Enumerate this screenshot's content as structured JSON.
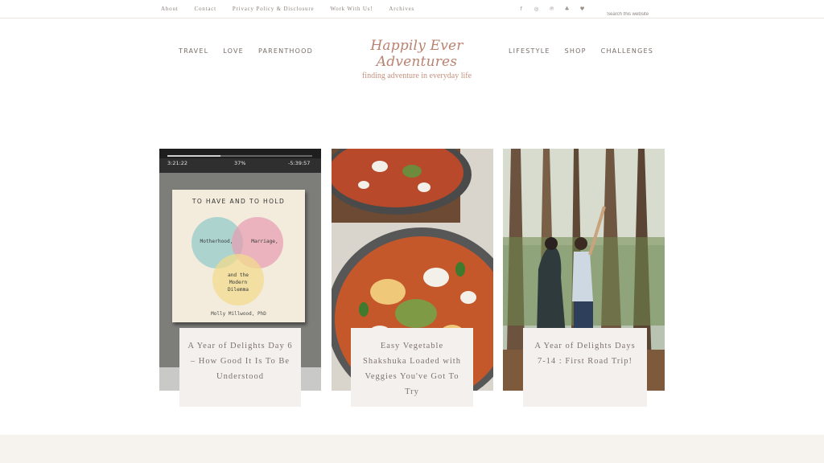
{
  "topbar": {
    "links": [
      "About",
      "Contact",
      "Privacy Policy & Disclosure",
      "Work With Us!",
      "Archives"
    ],
    "social_icons": [
      "facebook-icon",
      "instagram-icon",
      "pinterest-icon",
      "bloglovin-icon",
      "twitter-icon"
    ],
    "search_placeholder": "Search this website"
  },
  "header": {
    "nav_left": [
      "TRAVEL",
      "LOVE",
      "PARENTHOOD"
    ],
    "nav_right": [
      "LIFESTYLE",
      "SHOP",
      "CHALLENGES"
    ],
    "logo_title": "Happily Ever Adventures",
    "tagline": "finding adventure in everyday life"
  },
  "posts": [
    {
      "title": "A Year of Delights Day 6 – How Good It Is To Be Understood",
      "book": {
        "time_elapsed": "3:21:22",
        "percent": "37%",
        "time_remaining": "-5:39:57",
        "title": "TO HAVE AND TO HOLD",
        "circle_left": "Motherhood,",
        "circle_right": "Marriage,",
        "circle_bottom": "and the Modern Dilemma",
        "author": "Molly Millwood, PhD"
      }
    },
    {
      "title": "Easy Vegetable Shakshuka Loaded with Veggies You've Got To Try"
    },
    {
      "title": "A Year of Delights Days 7-14 : First Road Trip!"
    }
  ],
  "colors": {
    "accent": "#b98270",
    "caption_bg": "#f4f0ee",
    "footer_bg": "#f6f3ee"
  }
}
